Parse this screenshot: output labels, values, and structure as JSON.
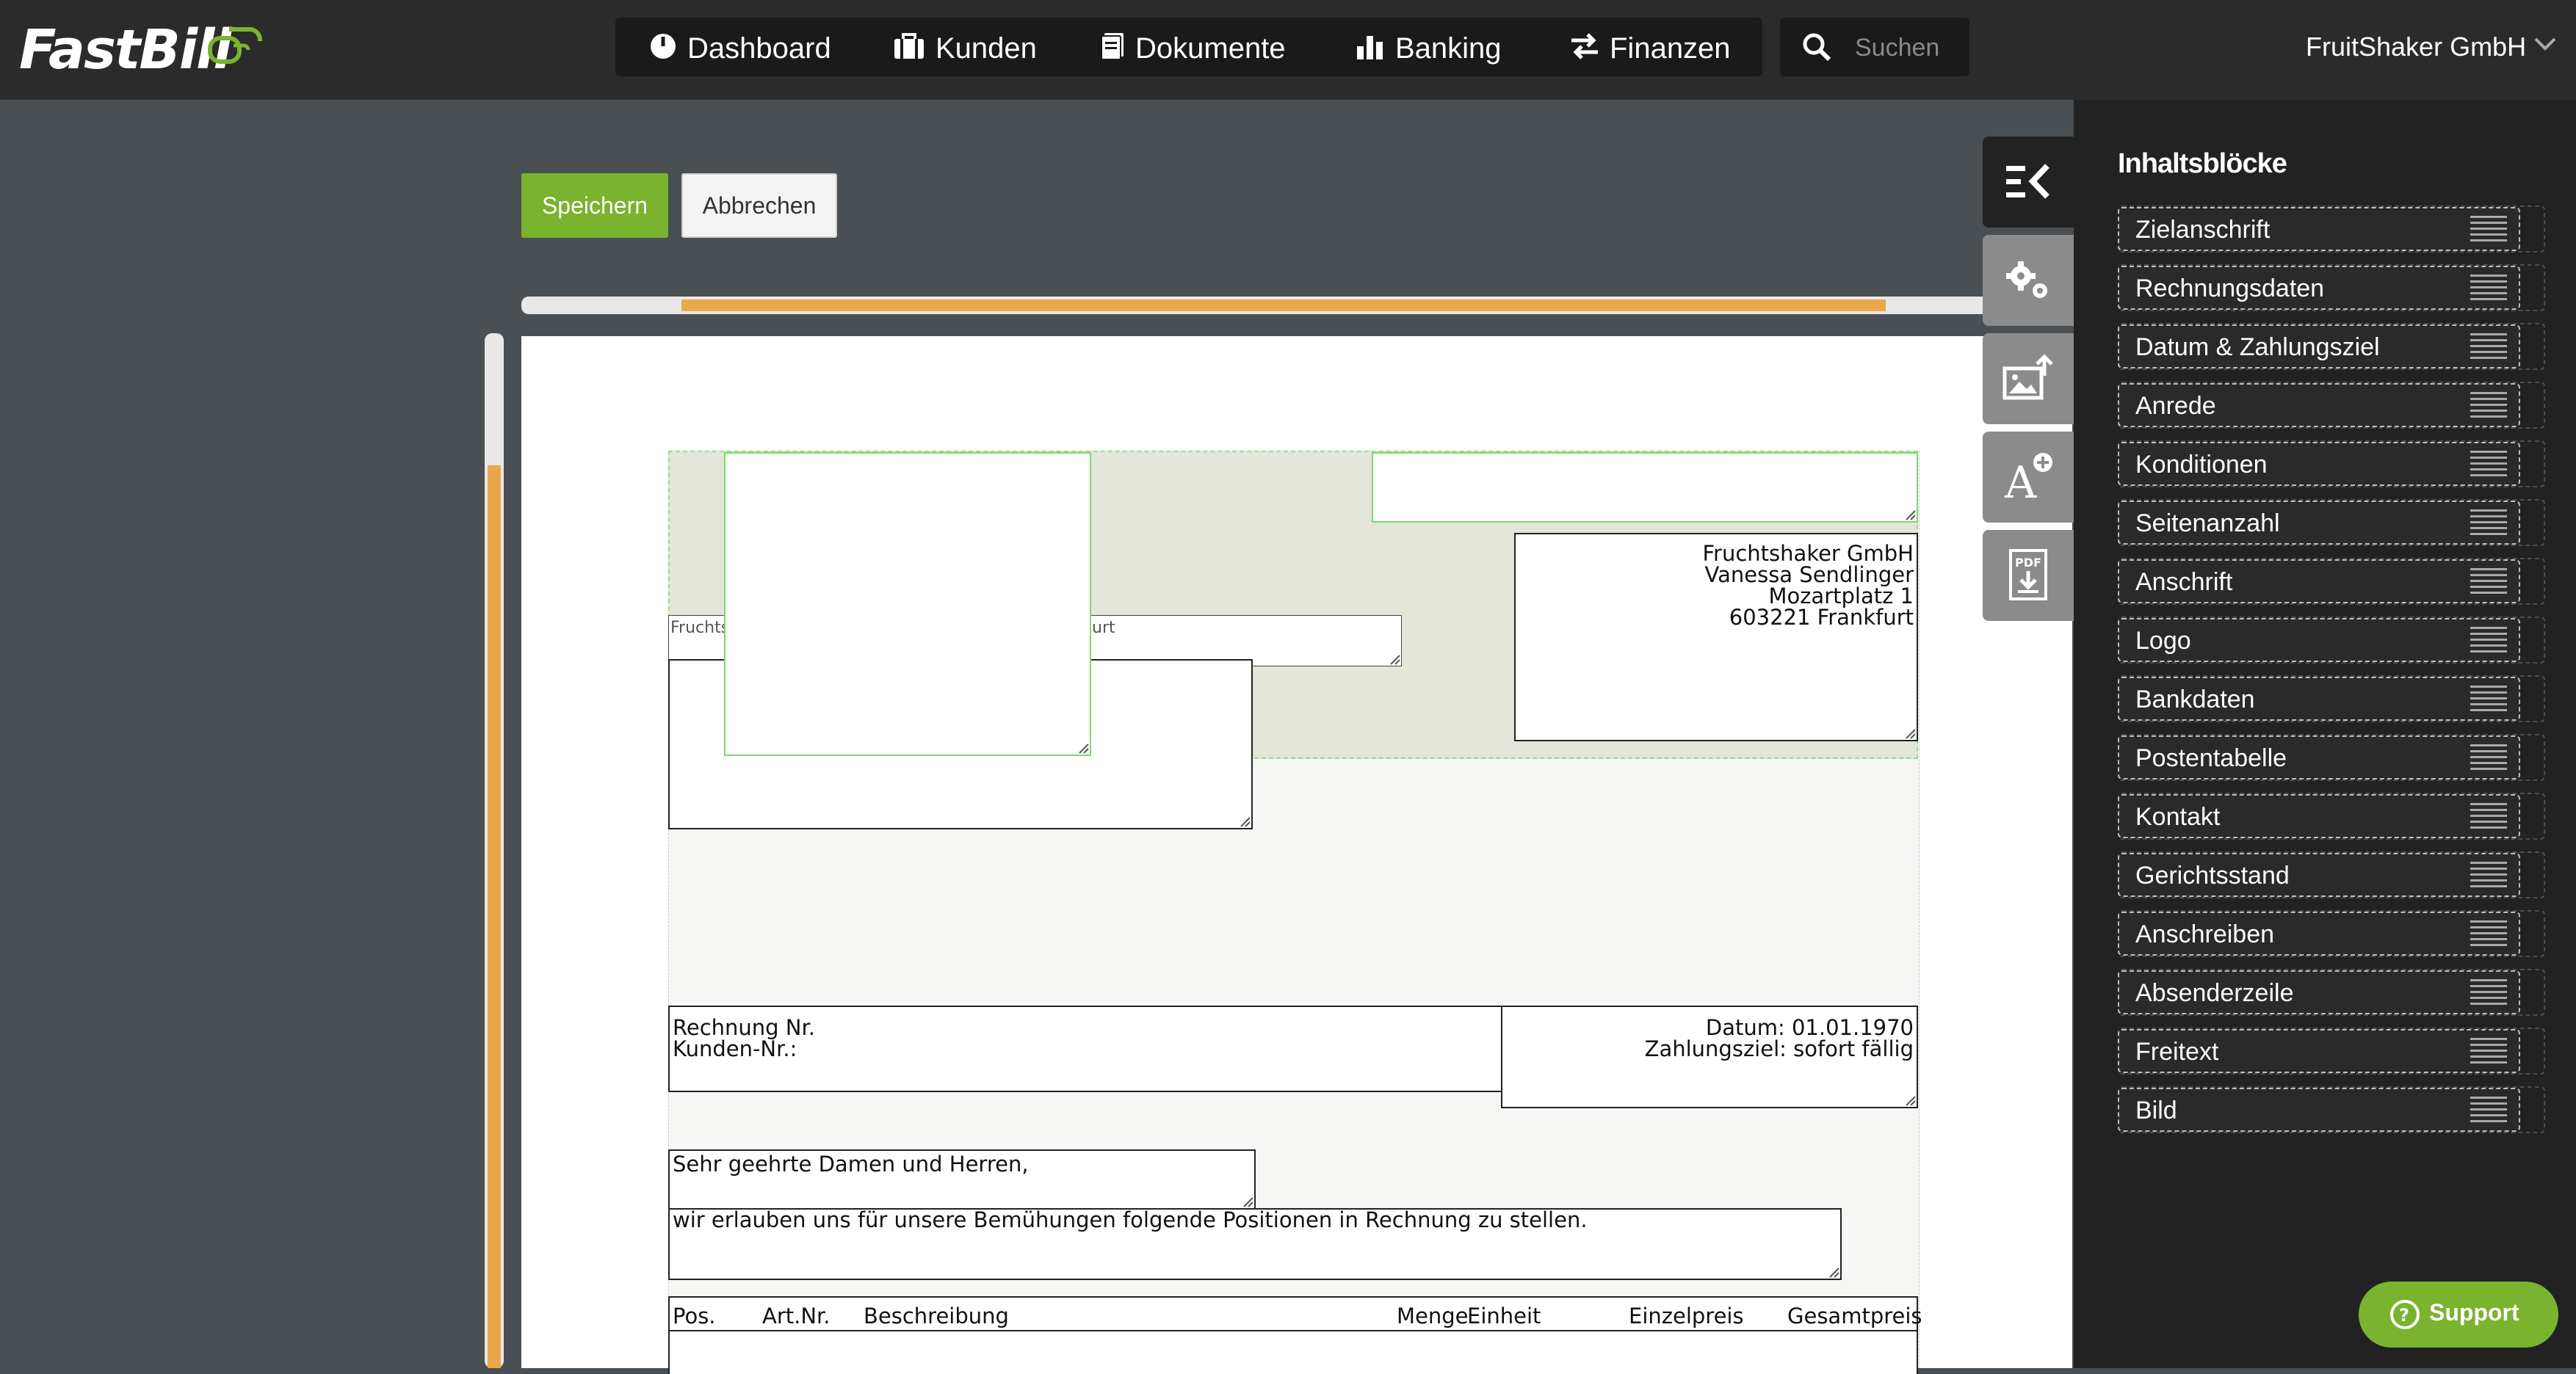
{
  "brand": {
    "name": "FastBill",
    "accent": "#7ab32e"
  },
  "nav": {
    "items": [
      {
        "label": "Dashboard",
        "icon": "gauge-icon"
      },
      {
        "label": "Kunden",
        "icon": "briefcase-icon"
      },
      {
        "label": "Dokumente",
        "icon": "document-icon"
      },
      {
        "label": "Banking",
        "icon": "bar-chart-icon"
      },
      {
        "label": "Finanzen",
        "icon": "transfer-arrows-icon"
      }
    ],
    "search_placeholder": "Suchen"
  },
  "account": {
    "company": "FruitShaker GmbH"
  },
  "toolbar": {
    "save_label": "Speichern",
    "cancel_label": "Abbrechen"
  },
  "document": {
    "sender_line_left": "Fruchts",
    "sender_line_right": "urt",
    "recipient": [
      "Fruchtshaker GmbH",
      "Vanessa Sendlinger",
      "Mozartplatz 1",
      "603221 Frankfurt"
    ],
    "invoice_no_label": "Rechnung Nr.",
    "customer_no_label": "Kunden-Nr.:",
    "date_line": "Datum: 01.01.1970",
    "payment_terms": "Zahlungsziel: sofort fällig",
    "salutation": "Sehr geehrte Damen und Herren,",
    "intro_text": "wir erlauben uns für unsere Bemühungen folgende Positionen in Rechnung zu stellen.",
    "table_columns": [
      "Pos.",
      "Art.Nr.",
      "Beschreibung",
      "Menge",
      "Einheit",
      "Einzelpreis",
      "Gesamtpreis"
    ]
  },
  "side_tabs": [
    "content-blocks-icon",
    "settings-gears-icon",
    "image-upload-icon",
    "font-add-icon",
    "pdf-download-icon"
  ],
  "panel": {
    "title": "Inhaltsblöcke",
    "blocks": [
      "Zielanschrift",
      "Rechnungsdaten",
      "Datum & Zahlungsziel",
      "Anrede",
      "Konditionen",
      "Seitenanzahl",
      "Anschrift",
      "Logo",
      "Bankdaten",
      "Postentabelle",
      "Kontakt",
      "Gerichtsstand",
      "Anschreiben",
      "Absenderzeile",
      "Freitext",
      "Bild"
    ]
  },
  "support": {
    "label": "Support"
  }
}
